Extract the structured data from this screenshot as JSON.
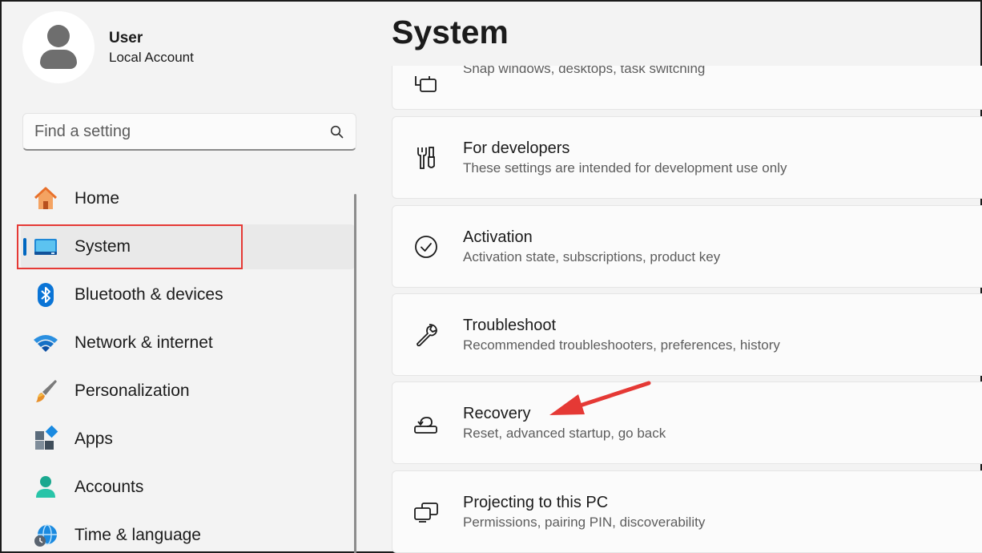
{
  "profile": {
    "name": "User",
    "account_type": "Local Account"
  },
  "search": {
    "placeholder": "Find a setting",
    "icon": "search-icon"
  },
  "nav": {
    "items": [
      {
        "label": "Home",
        "icon": "home-icon"
      },
      {
        "label": "System",
        "icon": "system-icon",
        "selected": true
      },
      {
        "label": "Bluetooth & devices",
        "icon": "bluetooth-icon"
      },
      {
        "label": "Network & internet",
        "icon": "wifi-icon"
      },
      {
        "label": "Personalization",
        "icon": "brush-icon"
      },
      {
        "label": "Apps",
        "icon": "apps-icon"
      },
      {
        "label": "Accounts",
        "icon": "accounts-icon"
      },
      {
        "label": "Time & language",
        "icon": "globe-clock-icon"
      }
    ]
  },
  "page": {
    "title": "System"
  },
  "cards": [
    {
      "title": "",
      "subtitle": "Snap windows, desktops, task switching",
      "icon": "multitasking-icon"
    },
    {
      "title": "For developers",
      "subtitle": "These settings are intended for development use only",
      "icon": "developer-tools-icon"
    },
    {
      "title": "Activation",
      "subtitle": "Activation state, subscriptions, product key",
      "icon": "check-circle-icon"
    },
    {
      "title": "Troubleshoot",
      "subtitle": "Recommended troubleshooters, preferences, history",
      "icon": "wrench-icon"
    },
    {
      "title": "Recovery",
      "subtitle": "Reset, advanced startup, go back",
      "icon": "recovery-icon"
    },
    {
      "title": "Projecting to this PC",
      "subtitle": "Permissions, pairing PIN, discoverability",
      "icon": "projecting-icon"
    }
  ],
  "colors": {
    "accent": "#0067c0",
    "annotation": "#e53935",
    "background": "#f3f3f3",
    "card": "#fbfbfb"
  }
}
